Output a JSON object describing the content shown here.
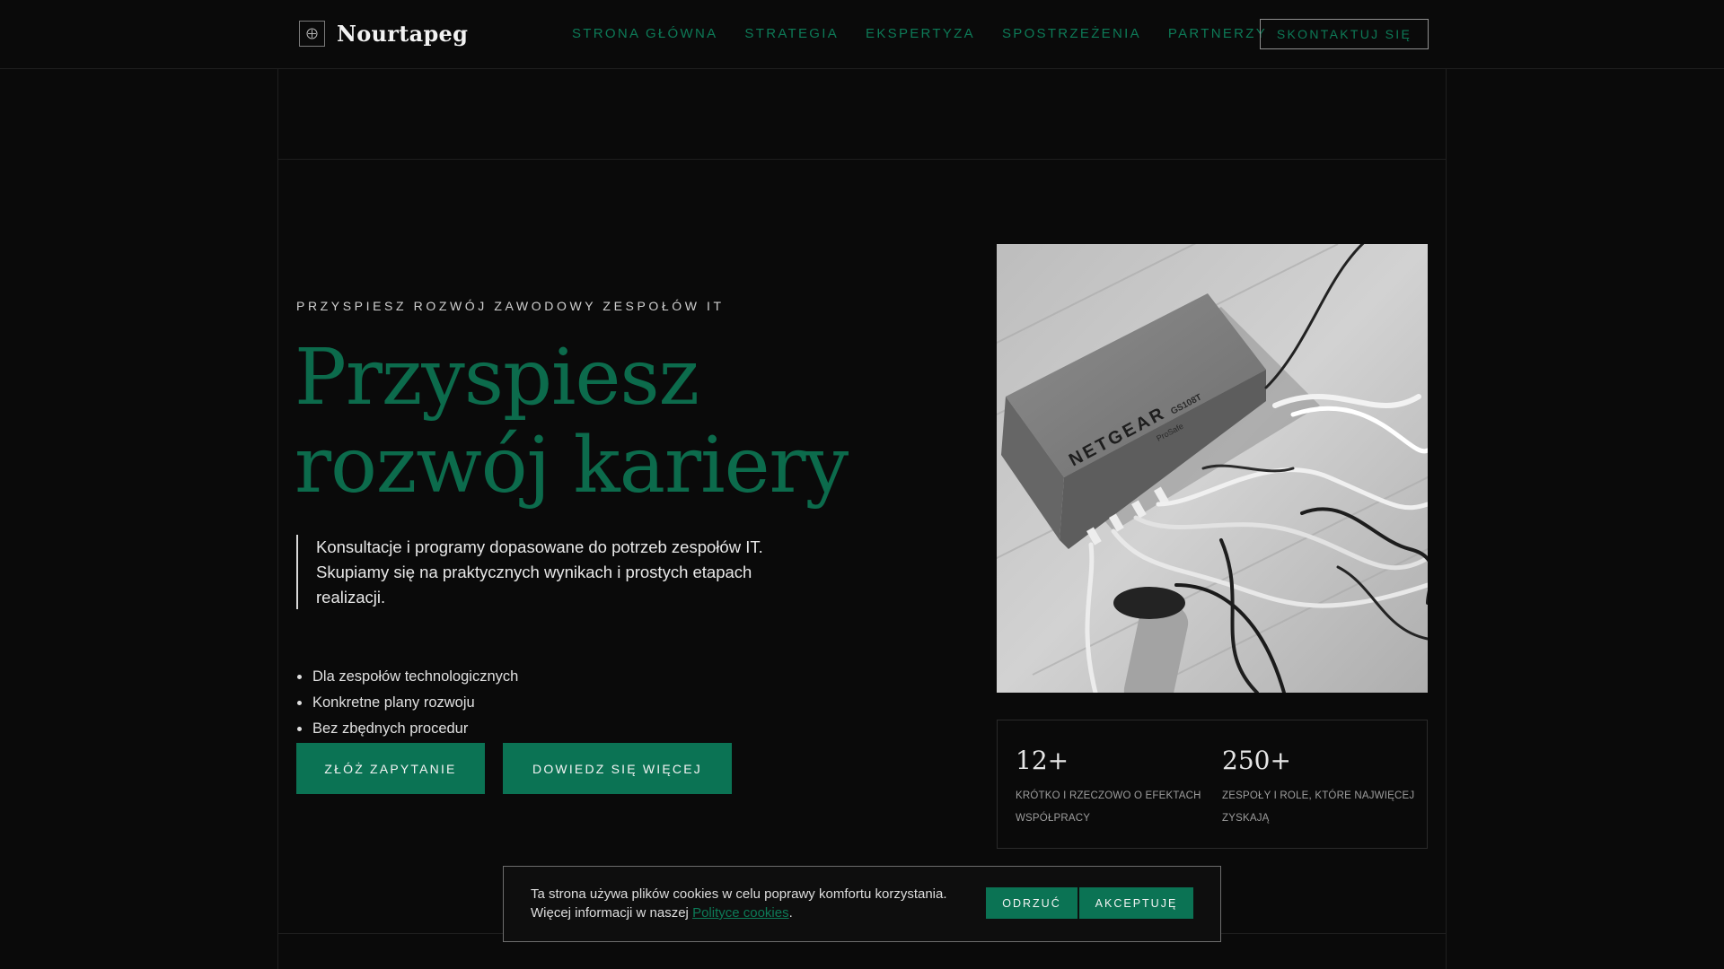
{
  "brand": {
    "name": "Nourtapeg",
    "icon": "crosshair-icon"
  },
  "nav": {
    "items": [
      {
        "label": "STRONA GŁÓWNA"
      },
      {
        "label": "STRATEGIA"
      },
      {
        "label": "EKSPERTYZA"
      },
      {
        "label": "SPOSTRZEŻENIA"
      },
      {
        "label": "PARTNERZY"
      }
    ],
    "cta": "SKONTAKTUJ SIĘ"
  },
  "hero": {
    "eyebrow": "PRZYSPIESZ ROZWÓJ ZAWODOWY ZESPOŁÓW IT",
    "title": "Przyspiesz rozwój kariery",
    "lead": "Konsultacje i programy dopasowane do potrzeb zespołów IT. Skupiamy się na praktycznych wynikach i prostych etapach realizacji.",
    "bullets": [
      "Dla zespołów technologicznych",
      "Konkretne plany rozwoju",
      "Bez zbędnych procedur"
    ],
    "primary_button": "ZŁÓŻ ZAPYTANIE",
    "secondary_button": "DOWIEDZ SIĘ WIĘCEJ",
    "image": {
      "label_text": "NETGEAR",
      "model_text": "GS108T",
      "sub_text": "ProSafe"
    }
  },
  "stats": [
    {
      "value": "12+",
      "label": "KRÓTKO I RZECZOWO O EFEKTACH WSPÓŁPRACY"
    },
    {
      "value": "250+",
      "label": "ZESPOŁY I ROLE, KTÓRE NAJWIĘCEJ ZYSKAJĄ"
    }
  ],
  "cookie": {
    "text_line1": "Ta strona używa plików cookies w celu poprawy komfortu korzystania.",
    "text_line2_prefix": "Więcej informacji w naszej",
    "link": "Polityce cookies",
    "suffix": ".",
    "reject": "ODRZUĆ",
    "accept": "AKCEPTUJĘ"
  },
  "colors": {
    "accent": "#0b7354",
    "accent_text": "#0d7a57",
    "background": "#0a0a0a"
  }
}
